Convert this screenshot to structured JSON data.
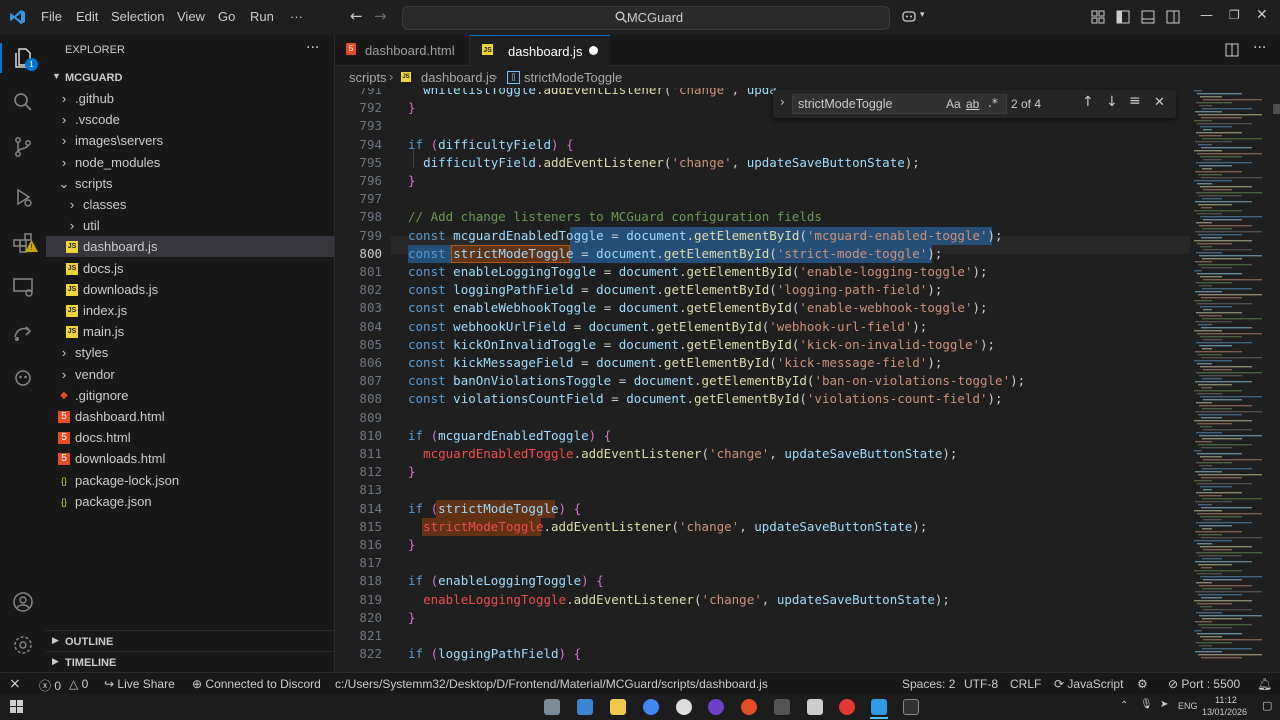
{
  "titlebar": {
    "menus": [
      "File",
      "Edit",
      "Selection",
      "View",
      "Go",
      "Run",
      "···"
    ],
    "search": "MCGuard"
  },
  "sidebar": {
    "header": "EXPLORER",
    "project": "MCGUARD",
    "items": [
      {
        "label": ".github",
        "type": "folder",
        "depth": 0
      },
      {
        "label": ".vscode",
        "type": "folder",
        "depth": 0
      },
      {
        "label": "images\\servers",
        "type": "folder",
        "depth": 0
      },
      {
        "label": "node_modules",
        "type": "folder",
        "depth": 0
      },
      {
        "label": "scripts",
        "type": "folder-open",
        "depth": 0
      },
      {
        "label": "classes",
        "type": "folder",
        "depth": 1
      },
      {
        "label": "util",
        "type": "folder",
        "depth": 1
      },
      {
        "label": "dashboard.js",
        "type": "js",
        "depth": 1,
        "selected": true
      },
      {
        "label": "docs.js",
        "type": "js",
        "depth": 1
      },
      {
        "label": "downloads.js",
        "type": "js",
        "depth": 1
      },
      {
        "label": "index.js",
        "type": "js",
        "depth": 1
      },
      {
        "label": "main.js",
        "type": "js",
        "depth": 1
      },
      {
        "label": "styles",
        "type": "folder",
        "depth": 0
      },
      {
        "label": "vendor",
        "type": "folder",
        "depth": 0
      },
      {
        "label": ".gitignore",
        "type": "git",
        "depth": 0
      },
      {
        "label": "dashboard.html",
        "type": "html",
        "depth": 0
      },
      {
        "label": "docs.html",
        "type": "html",
        "depth": 0
      },
      {
        "label": "downloads.html",
        "type": "html",
        "depth": 0
      },
      {
        "label": "package-lock.json",
        "type": "json",
        "depth": 0
      },
      {
        "label": "package.json",
        "type": "json",
        "depth": 0
      }
    ],
    "outline": "OUTLINE",
    "timeline": "TIMELINE"
  },
  "tabs": [
    {
      "label": "dashboard.html",
      "active": false
    },
    {
      "label": "dashboard.js",
      "active": true
    }
  ],
  "breadcrumb": {
    "folder": "scripts",
    "file": "dashboard.js",
    "symbol": "strictModeToggle"
  },
  "find": {
    "query": "strictModeToggle",
    "result": "2 of 4"
  },
  "code_lines": [
    {
      "n": "791",
      "html": "  <span class='id'>whitelistToggle</span>.<span class='fn'>addEventListener</span>(<span class='str'>'change'</span>, <span class='id'>upda</span>"
    },
    {
      "n": "792",
      "html": "<span class='br2'>}</span>"
    },
    {
      "n": "793",
      "html": ""
    },
    {
      "n": "794",
      "html": "<span class='kw'>if</span> <span class='br2'>(</span><span class='id'>difficultyField</span><span class='br2'>)</span> <span class='br2'>{</span>"
    },
    {
      "n": "795",
      "html": "  <span class='id'>difficultyField</span>.<span class='fn'>addEventListener</span>(<span class='str'>'change'</span>, <span class='id'>updateSaveButtonState</span>);"
    },
    {
      "n": "796",
      "html": "<span class='br2'>}</span>"
    },
    {
      "n": "797",
      "html": ""
    },
    {
      "n": "798",
      "html": "<span class='cm'>// Add change listeners to MCGuard configuration fields</span>"
    },
    {
      "n": "799",
      "html": "<span class='kw'>const</span> <span class='id'>mcguardEnabledToggle</span> = <span class='id'>document</span>.<span class='fn'>getElementById</span>(<span class='str'>'mcguard-enabled-toggle'</span>);"
    },
    {
      "n": "800",
      "html": "<span class='kw'>const</span> <span class='id'>strictModeToggle</span> = <span class='id'>document</span>.<span class='fn'>getElementById</span>(<span class='str'>'strict-mode-toggle'</span>);"
    },
    {
      "n": "801",
      "html": "<span class='kw'>const</span> <span class='id'>enableLoggingToggle</span> = <span class='id'>document</span>.<span class='fn'>getElementById</span>(<span class='str'>'enable-logging-toggle'</span>);"
    },
    {
      "n": "802",
      "html": "<span class='kw'>const</span> <span class='id'>loggingPathField</span> = <span class='id'>document</span>.<span class='fn'>getElementById</span>(<span class='str'>'logging-path-field'</span>);"
    },
    {
      "n": "803",
      "html": "<span class='kw'>const</span> <span class='id'>enableWebhookToggle</span> = <span class='id'>document</span>.<span class='fn'>getElementById</span>(<span class='str'>'enable-webhook-toggle'</span>);"
    },
    {
      "n": "804",
      "html": "<span class='kw'>const</span> <span class='id'>webhookUrlField</span> = <span class='id'>document</span>.<span class='fn'>getElementById</span>(<span class='str'>'webhook-url-field'</span>);"
    },
    {
      "n": "805",
      "html": "<span class='kw'>const</span> <span class='id'>kickOnInvalidToggle</span> = <span class='id'>document</span>.<span class='fn'>getElementById</span>(<span class='str'>'kick-on-invalid-toggle'</span>);"
    },
    {
      "n": "806",
      "html": "<span class='kw'>const</span> <span class='id'>kickMessageField</span> = <span class='id'>document</span>.<span class='fn'>getElementById</span>(<span class='str'>'kick-message-field'</span>);"
    },
    {
      "n": "807",
      "html": "<span class='kw'>const</span> <span class='id'>banOnViolationsToggle</span> = <span class='id'>document</span>.<span class='fn'>getElementById</span>(<span class='str'>'ban-on-violations-toggle'</span>);"
    },
    {
      "n": "808",
      "html": "<span class='kw'>const</span> <span class='id'>violationsCountField</span> = <span class='id'>document</span>.<span class='fn'>getElementById</span>(<span class='str'>'violations-count-field'</span>);"
    },
    {
      "n": "809",
      "html": ""
    },
    {
      "n": "810",
      "html": "<span class='kw'>if</span> <span class='br2'>(</span><span class='id'>mcguardEnabledToggle</span><span class='br2'>)</span> <span class='br2'>{</span>"
    },
    {
      "n": "811",
      "html": "  <span class='fnr'>mcguardEnabledToggle</span>.<span class='fn'>addEventListener</span>(<span class='str'>'change'</span>, <span class='id'>updateSaveButtonState</span>);"
    },
    {
      "n": "812",
      "html": "<span class='br2'>}</span>"
    },
    {
      "n": "813",
      "html": ""
    },
    {
      "n": "814",
      "html": "<span class='kw'>if</span> <span class='br2'>(</span><span class='id'>strictModeToggle</span><span class='br2'>)</span> <span class='br2'>{</span>"
    },
    {
      "n": "815",
      "html": "  <span class='fnr'>strictModeToggle</span>.<span class='fn'>addEventListener</span>(<span class='str'>'change'</span>, <span class='id'>updateSaveButtonState</span>);"
    },
    {
      "n": "816",
      "html": "<span class='br2'>}</span>"
    },
    {
      "n": "817",
      "html": ""
    },
    {
      "n": "818",
      "html": "<span class='kw'>if</span> <span class='br2'>(</span><span class='id'>enableLoggingToggle</span><span class='br2'>)</span> <span class='br2'>{</span>"
    },
    {
      "n": "819",
      "html": "  <span class='fnr'>enableLoggingToggle</span>.<span class='fn'>addEventListener</span>(<span class='str'>'change'</span>, <span class='id'>updateSaveButtonState</span>);"
    },
    {
      "n": "820",
      "html": "<span class='br2'>}</span>"
    },
    {
      "n": "821",
      "html": ""
    },
    {
      "n": "822",
      "html": "<span class='kw'>if</span> <span class='br2'>(</span><span class='id'>loggingPathField</span><span class='br2'>)</span> <span class='br2'>{</span>"
    }
  ],
  "statusbar": {
    "errors": "0",
    "warnings": "0",
    "liveshare": "Live Share",
    "discord": "Connected to Discord",
    "path": "c:/Users/Systemm32/Desktop/D/Frontend/Material/MCGuard/scripts/dashboard.js",
    "spaces": "Spaces: 2",
    "encoding": "UTF-8",
    "eol": "CRLF",
    "language": "JavaScript",
    "port": "Port : 5500"
  },
  "taskbar": {
    "lang": "ENG",
    "time": "11:12",
    "date": "13/01/2026"
  },
  "colors": {
    "accent": "#0078d4",
    "selection": "#264f78",
    "match": "#623315"
  }
}
